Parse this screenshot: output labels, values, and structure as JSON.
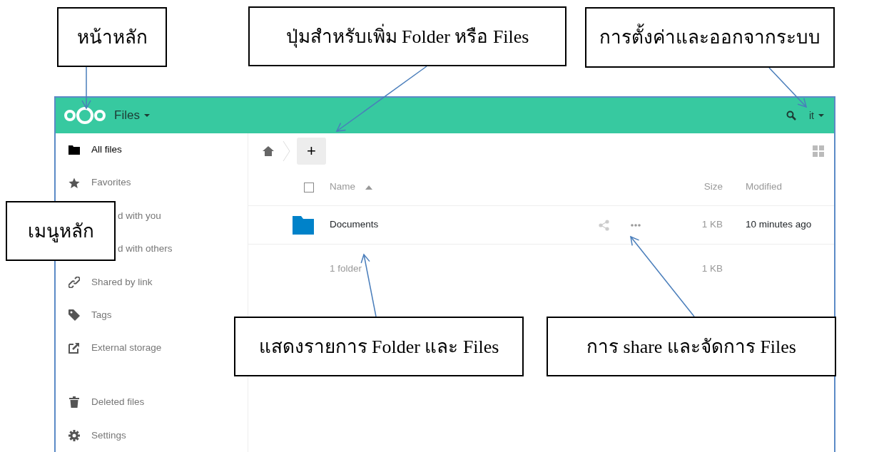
{
  "annotations": [
    {
      "text": "หน้าหลัก"
    },
    {
      "text": "ปุ่มสำหรับเพิ่ม Folder หรือ Files"
    },
    {
      "text": "การตั้งค่าและออกจากระบบ"
    },
    {
      "text": "เมนูหลัก"
    },
    {
      "text": "แสดงรายการ Folder และ Files"
    },
    {
      "text": "การ share และจัดการ Files"
    }
  ],
  "header": {
    "app_name": "Files",
    "user": "it"
  },
  "sidebar": {
    "items": [
      {
        "label": "All files",
        "kind": "folder",
        "selected": true
      },
      {
        "label": "Favorites",
        "kind": "star",
        "selected": false
      },
      {
        "label": "d with you",
        "kind": "covered",
        "selected": false
      },
      {
        "label": "d with others",
        "kind": "covered",
        "selected": false
      },
      {
        "label": "Shared by link",
        "kind": "link",
        "selected": false
      },
      {
        "label": "Tags",
        "kind": "tag",
        "selected": false
      },
      {
        "label": "External storage",
        "kind": "external",
        "selected": false
      }
    ],
    "bottom_items": [
      {
        "label": "Deleted files",
        "kind": "trash",
        "selected": false
      },
      {
        "label": "Settings",
        "kind": "gear",
        "selected": false
      }
    ]
  },
  "toolbar": {
    "new_button": "+"
  },
  "table": {
    "select_all": {
      "checked": false
    },
    "columns": [
      {
        "label": "Name",
        "sorted": true
      },
      {
        "label": "Size",
        "sorted": false
      },
      {
        "label": "Modified",
        "sorted": false
      }
    ],
    "rows": [
      {
        "name": "Documents",
        "kind": "folder",
        "size": "1 KB",
        "modified": "10 minutes ago"
      }
    ],
    "summary": {
      "label": "1 folder",
      "size": "1 KB"
    }
  }
}
